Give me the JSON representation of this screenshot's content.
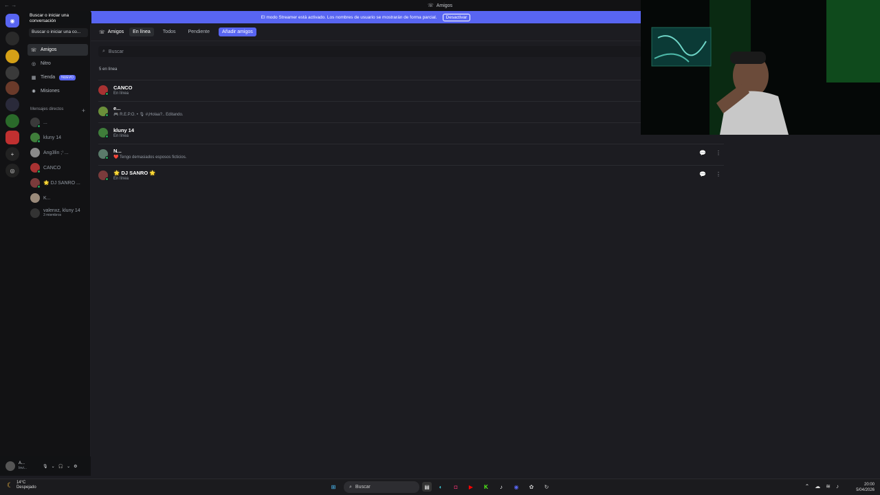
{
  "window": {
    "title": "Amigos",
    "nav_arrows": "← →"
  },
  "banner": {
    "text": "El modo Streamer está activado. Los nombres de usuario se mostrarán de forma parcial.",
    "button": "Desactivar",
    "color": "#5865f2"
  },
  "tooltip": {
    "text": "Buscar o iniciar una conversación"
  },
  "sidebar": {
    "search_label": "Buscar o iniciar una co...",
    "nav": [
      {
        "label": "Amigos",
        "icon": "friends-icon",
        "glyph": "☏"
      },
      {
        "label": "Nitro",
        "icon": "nitro-icon",
        "glyph": "◎"
      },
      {
        "label": "Tienda",
        "icon": "shop-icon",
        "glyph": "▦",
        "badge": "NUEVO"
      },
      {
        "label": "Misiones",
        "icon": "quests-icon",
        "glyph": "✺"
      }
    ],
    "dm_header": "Mensajes directos",
    "dm_add": "+",
    "dms": [
      {
        "name": "...",
        "sub": "",
        "color": "#3a3a3a"
      },
      {
        "name": "kluny 14",
        "sub": "",
        "color": "#3f7d3a"
      },
      {
        "name": "Ang3lin ;⁾ ...",
        "sub": "",
        "color": "#8a8a8a"
      },
      {
        "name": "CANCO",
        "sub": "",
        "color": "#a83232"
      },
      {
        "name": "🌟 DJ SANRO ...",
        "sub": "",
        "color": "#7a3b3b"
      },
      {
        "name": "K...",
        "sub": "",
        "color": "#9a8a7a"
      },
      {
        "name": "valenxz, kluny 14",
        "sub": "3 miembros",
        "color": "#333333"
      }
    ]
  },
  "userbar": {
    "name": "A...",
    "status": "Invi...",
    "icons": [
      "🎙",
      "⌄",
      "🎧",
      "⌄",
      "⚙"
    ]
  },
  "topbar": {
    "title": "Amigos",
    "tabs": [
      "En línea",
      "Todos",
      "Pendiente"
    ],
    "add_button": "Añadir amigos"
  },
  "search": {
    "placeholder": "Buscar"
  },
  "friends": {
    "count_label": "5 en línea",
    "list": [
      {
        "name": "CANCO",
        "status": "En línea",
        "color": "#a83232"
      },
      {
        "name": "e...",
        "status": "🎮 R.E.P.O. • 🎙 #¡Holaa?.. Editando.",
        "color": "#6b8f3a"
      },
      {
        "name": "kluny 14",
        "status": "En línea",
        "color": "#3f7d3a"
      },
      {
        "name": "N...",
        "status": "❤️ Tengo demasiados esposos ficticios.",
        "color": "#5a7a6a"
      },
      {
        "name": "🌟 DJ SANRO 🌟",
        "status": "En línea",
        "color": "#7a3b3b"
      }
    ],
    "message_icon": "💬",
    "more_icon": "⋮"
  },
  "taskbar": {
    "weather_temp": "14°C",
    "weather_desc": "Despejado",
    "search": "Buscar",
    "time": "20:00",
    "date": "5/04/2026"
  }
}
